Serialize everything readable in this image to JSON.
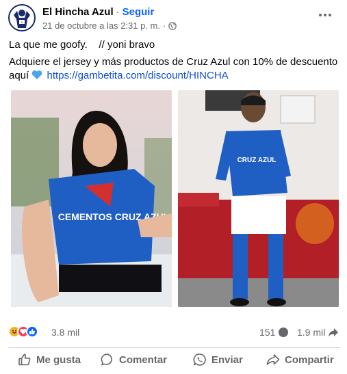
{
  "post": {
    "page_name": "El Hincha Azul",
    "separator": "·",
    "follow_label": "Seguir",
    "timestamp": "21 de octubre a las 2:31 p. m.",
    "meta_separator": "·",
    "text_line1": "La que me goofy.    // yoni bravo",
    "text_line2": "Adquiere el jersey y más productos de Cruz Azul con 10% de descuento aquí",
    "link": "https://gambetita.com/discount/HINCHA"
  },
  "photos": [
    {
      "name": "photo-woman-jersey",
      "jersey_text": "CEMENTOS CRUZ AZUL"
    },
    {
      "name": "photo-man-jersey",
      "jersey_text": "CRUZ AZUL"
    }
  ],
  "stats": {
    "reactions_count": "3.8 mil",
    "comments_count": "151",
    "shares_count": "1.9 mil",
    "reaction_icons": [
      "haha-icon",
      "love-icon",
      "like-icon"
    ]
  },
  "actions": {
    "like_label": "Me gusta",
    "comment_label": "Comentar",
    "send_label": "Enviar",
    "share_label": "Compartir"
  },
  "colors": {
    "link": "#0b4fd8",
    "follow": "#0866ff",
    "muted": "#65676b",
    "jersey_blue": "#1f5fc4"
  }
}
